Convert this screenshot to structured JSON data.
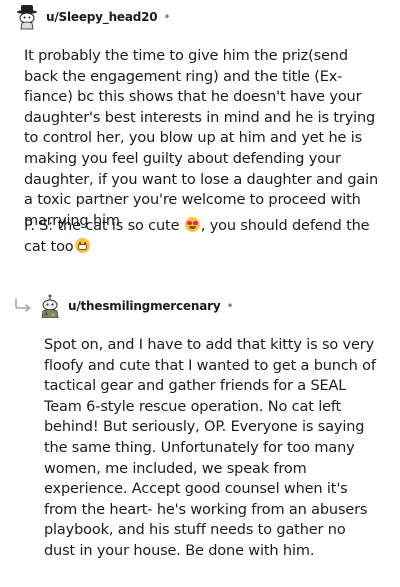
{
  "comments": [
    {
      "username": "u/Sleepy_head20",
      "separator": "•",
      "paragraph1": "It probably the time to give him the priz(send back the engagement ring) and the title (Ex-fiance) bc this shows that he doesn't have your daughter's best interests in mind and he is trying to control her, you blow up at him and yet he is making you feel guilty about defending your daughter, if you want to lose a daughter and gain a toxic partner you're welcome to proceed with marrying him",
      "paragraph2_part1": "P. S: the cat is so cute ",
      "paragraph2_emoji1": "heart-eyes-emoji",
      "paragraph2_part2": ", you should defend the cat too",
      "paragraph2_emoji2": "grinning-emoji"
    },
    {
      "username": "u/thesmilingmercenary",
      "separator": "•",
      "body": "Spot on, and I have to add that kitty is so very floofy and cute that I wanted to get a bunch of tactical gear and gather friends for a SEAL Team 6-style rescue operation. No cat left behind! But seriously, OP. Everyone is saying the same thing. Unfortunately for too many women, me included, we speak from experience. Accept good counsel when it's from the heart- he's working from an abusers playbook, and his stuff needs to gather no dust in your house. Be done with him."
    }
  ],
  "colors": {
    "text": "#1c1c1c",
    "meta": "#7c7c7c",
    "reply_arrow": "#a8a8a8"
  }
}
